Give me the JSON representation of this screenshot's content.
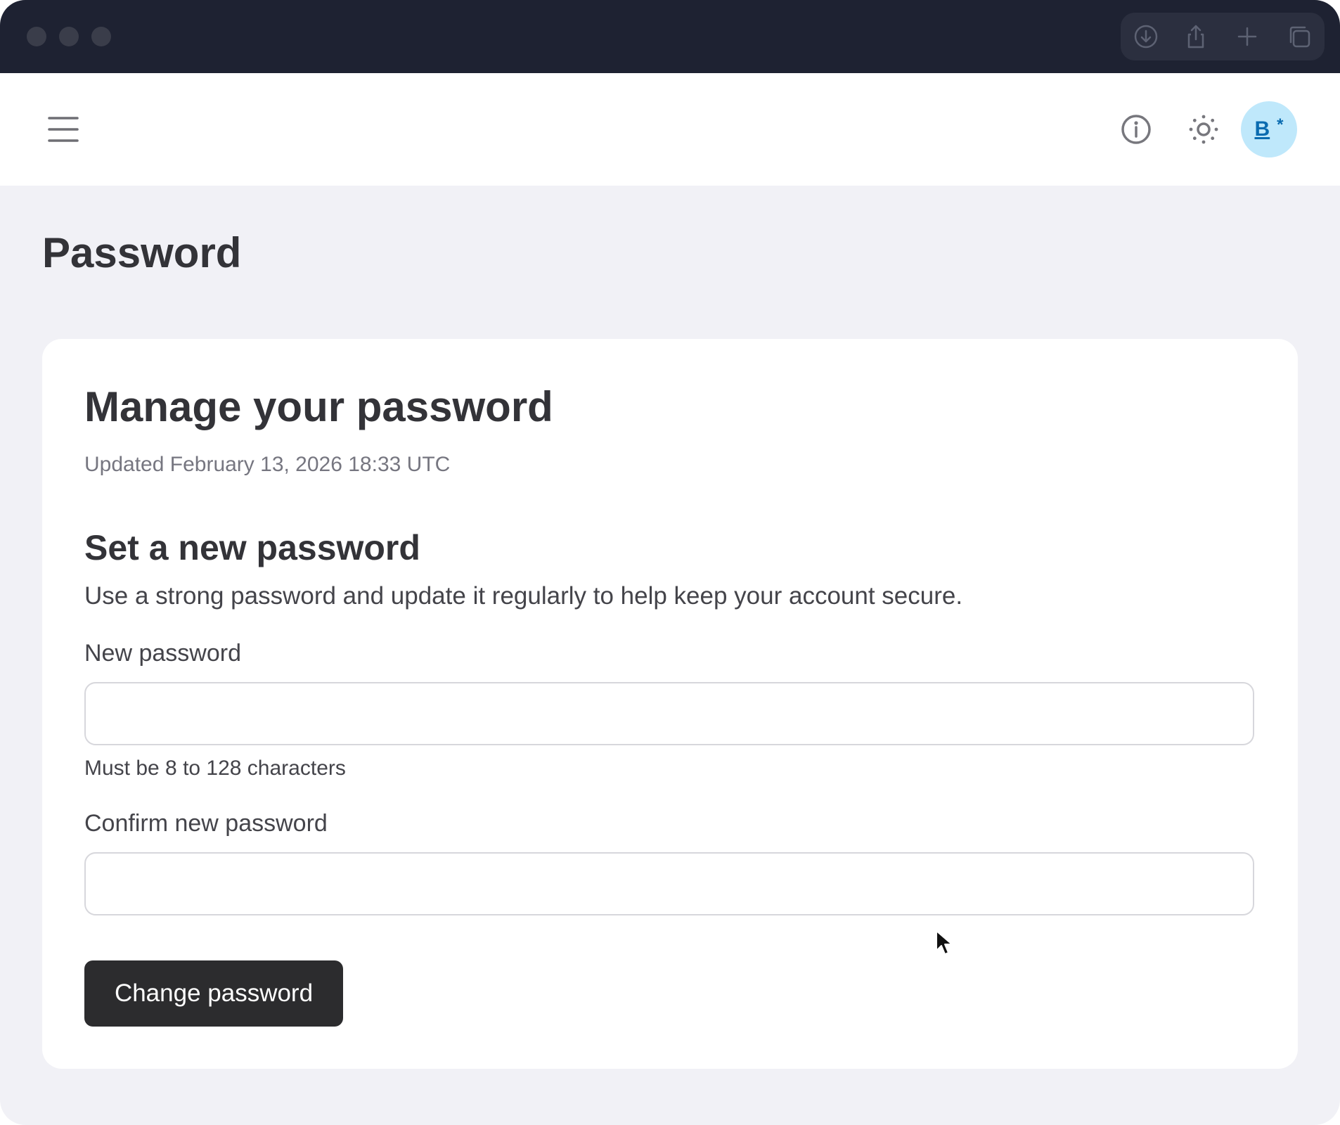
{
  "window": {
    "traffic_lights": [
      "close",
      "minimize",
      "zoom"
    ],
    "toolbar_icons": [
      "download-icon",
      "share-icon",
      "new-tab-icon",
      "tabs-overview-icon"
    ]
  },
  "header": {
    "menu_icon": "hamburger-menu-icon",
    "info_icon": "info-icon",
    "theme_icon": "sun-icon",
    "avatar": {
      "initial": "B",
      "badge": "*",
      "background": "#bfe8fb",
      "color": "#0a6bb0"
    }
  },
  "page": {
    "title": "Password"
  },
  "card": {
    "title": "Manage your password",
    "updated": "Updated February 13, 2026 18:33 UTC",
    "section_title": "Set a new password",
    "section_description": "Use a strong password and update it regularly to help keep your account secure.",
    "new_password": {
      "label": "New password",
      "value": "",
      "hint": "Must be 8 to 128 characters"
    },
    "confirm_password": {
      "label": "Confirm new password",
      "value": ""
    },
    "submit_label": "Change password"
  },
  "colors": {
    "titlebar": "#1e2232",
    "page_background": "#f1f1f6",
    "card_background": "#ffffff",
    "primary_button": "#2c2c2e",
    "text_dark": "#333338"
  }
}
